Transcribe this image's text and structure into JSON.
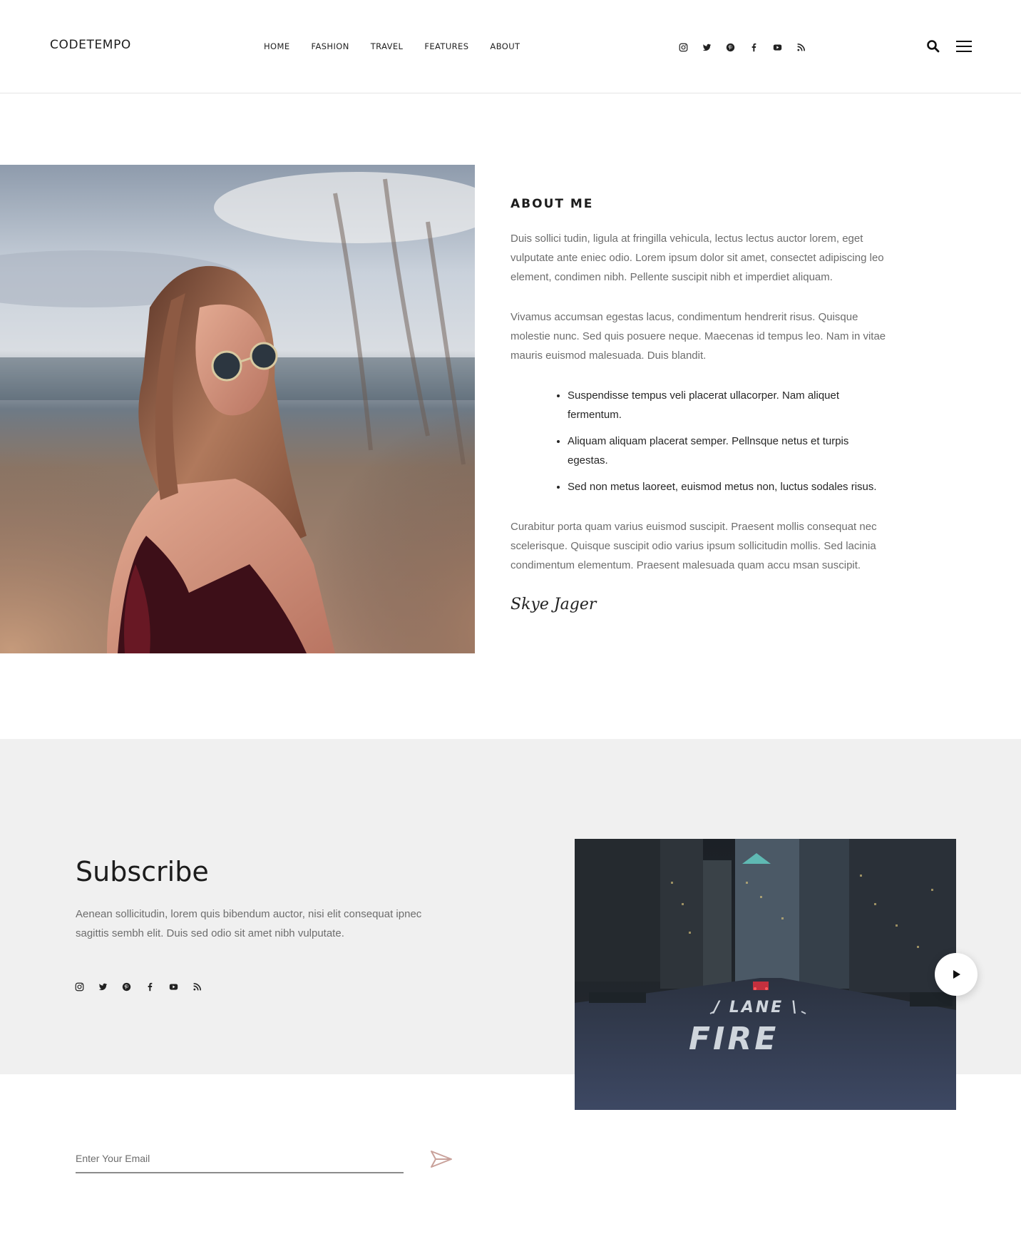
{
  "header": {
    "logo": "CODETEMPO",
    "nav": [
      "HOME",
      "FASHION",
      "TRAVEL",
      "FEATURES",
      "ABOUT"
    ],
    "social_icons": [
      "instagram-icon",
      "twitter-icon",
      "pinterest-icon",
      "facebook-icon",
      "youtube-icon",
      "rss-icon"
    ]
  },
  "about": {
    "title": "ABOUT ME",
    "paragraph1": "Duis sollici tudin, ligula at fringilla vehicula, lectus lectus auctor lorem, eget vulputate ante eniec odio. Lorem ipsum dolor sit amet, consectet adipiscing leo element, condimen nibh. Pellente suscipit nibh et imperdiet aliquam.",
    "paragraph2": "Vivamus accumsan egestas lacus, condimentum hendrerit risus. Quisque molestie nunc. Sed quis posuere neque. Maecenas id tempus leo. Nam in vitae mauris euismod malesuada. Duis blandit.",
    "bullets": [
      "Suspendisse tempus veli placerat ullacorper. Nam aliquet fermentum.",
      "Aliquam aliquam placerat semper. Pellnsque netus et turpis egestas.",
      "Sed non metus laoreet, euismod metus non, luctus sodales risus."
    ],
    "paragraph3": "Curabitur porta quam varius euismod suscipit. Praesent mollis consequat nec scelerisque. Quisque suscipit odio varius ipsum sollicitudin mollis. Sed lacinia condimentum elementum. Praesent malesuada quam accu msan suscipit.",
    "signature": "Skye Jager"
  },
  "subscribe": {
    "title": "Subscribe",
    "text": "Aenean sollicitudin, lorem quis bibendum auctor, nisi elit consequat ipnec sagittis sembh elit. Duis sed odio sit amet nibh vulputate.",
    "email_placeholder": "Enter Your Email",
    "social_icons": [
      "instagram-icon",
      "twitter-icon",
      "pinterest-icon",
      "facebook-icon",
      "youtube-icon",
      "rss-icon"
    ],
    "video_road_text_1": "/ LANE \\",
    "video_road_text_2": "FIRE"
  },
  "colors": {
    "band_bg": "#f0f0f0",
    "send_accent": "#c9a19a",
    "text_muted": "#6d6d6d"
  }
}
